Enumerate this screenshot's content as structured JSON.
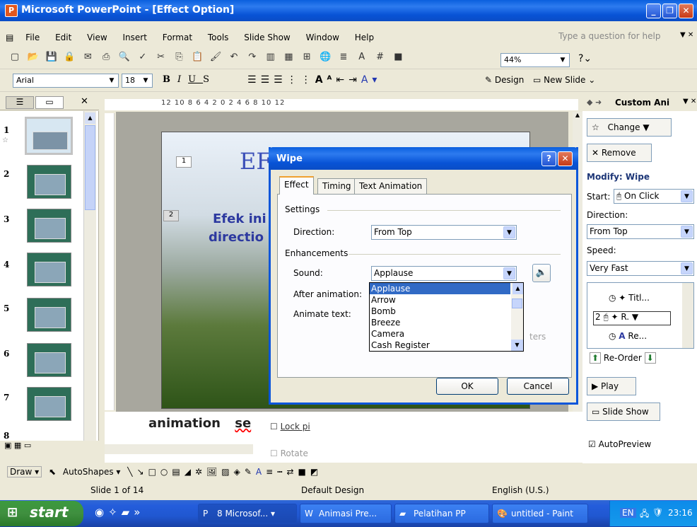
{
  "window": {
    "title": "Microsoft PowerPoint - [Effect Option]",
    "app_icon": "powerpoint-icon"
  },
  "menu": [
    "File",
    "Edit",
    "View",
    "Insert",
    "Format",
    "Tools",
    "Slide Show",
    "Window",
    "Help"
  ],
  "help_box": {
    "placeholder": "Type a question for help"
  },
  "toolbar1": {
    "zoom": "44%"
  },
  "toolbar2": {
    "font": "Arial",
    "size": "18",
    "design_label": "Design",
    "new_slide_label": "New Slide"
  },
  "ruler": {
    "text": "12 10 8 6 4 2 0 2 4 6 8 10 12"
  },
  "slides": {
    "numbers": [
      "1",
      "2",
      "3",
      "4",
      "5",
      "6",
      "7",
      "8"
    ]
  },
  "slide": {
    "title": "EF",
    "body": "Efek ini",
    "body2": "directio",
    "badge1": "1",
    "badge2": "2",
    "bottom_text": "animation",
    "bottom_text2": "se"
  },
  "notes": {
    "lock_label": "Lock pi",
    "rotate_label": "Rotate"
  },
  "dialog": {
    "title": "Wipe",
    "tabs": [
      "Effect",
      "Timing",
      "Text Animation"
    ],
    "settings_label": "Settings",
    "direction_label": "Direction:",
    "direction_value": "From Top",
    "enhancements_label": "Enhancements",
    "sound_label": "Sound:",
    "sound_value": "Applause",
    "after_label": "After animation:",
    "animate_label": "Animate text:",
    "letters_hint": "ters",
    "ok": "OK",
    "cancel": "Cancel",
    "sound_options": [
      "Applause",
      "Arrow",
      "Bomb",
      "Breeze",
      "Camera",
      "Cash Register"
    ]
  },
  "taskpane": {
    "title": "Custom Ani",
    "change": "Change",
    "remove": "Remove",
    "modify": "Modify: Wipe",
    "start_label": "Start:",
    "start_value": "On Click",
    "direction_label": "Direction:",
    "direction_value": "From Top",
    "speed_label": "Speed:",
    "speed_value": "Very Fast",
    "list": [
      {
        "num": "",
        "text": "Titl..."
      },
      {
        "num": "2",
        "text": "R."
      },
      {
        "num": "",
        "text": "Re..."
      }
    ],
    "reorder": "Re-Order",
    "play": "Play",
    "slideshow": "Slide Show",
    "autopreview": "AutoPreview"
  },
  "drawbar": {
    "draw": "Draw",
    "autoshapes": "AutoShapes"
  },
  "status": {
    "slide": "Slide 1 of 14",
    "design": "Default Design",
    "language": "English (U.S.)"
  },
  "taskbar": {
    "start": "start",
    "tasks": [
      "8 Microsof...",
      "Animasi Pre...",
      "Pelatihan PP",
      "untitled - Paint"
    ],
    "lang": "EN",
    "clock": "23:16"
  }
}
